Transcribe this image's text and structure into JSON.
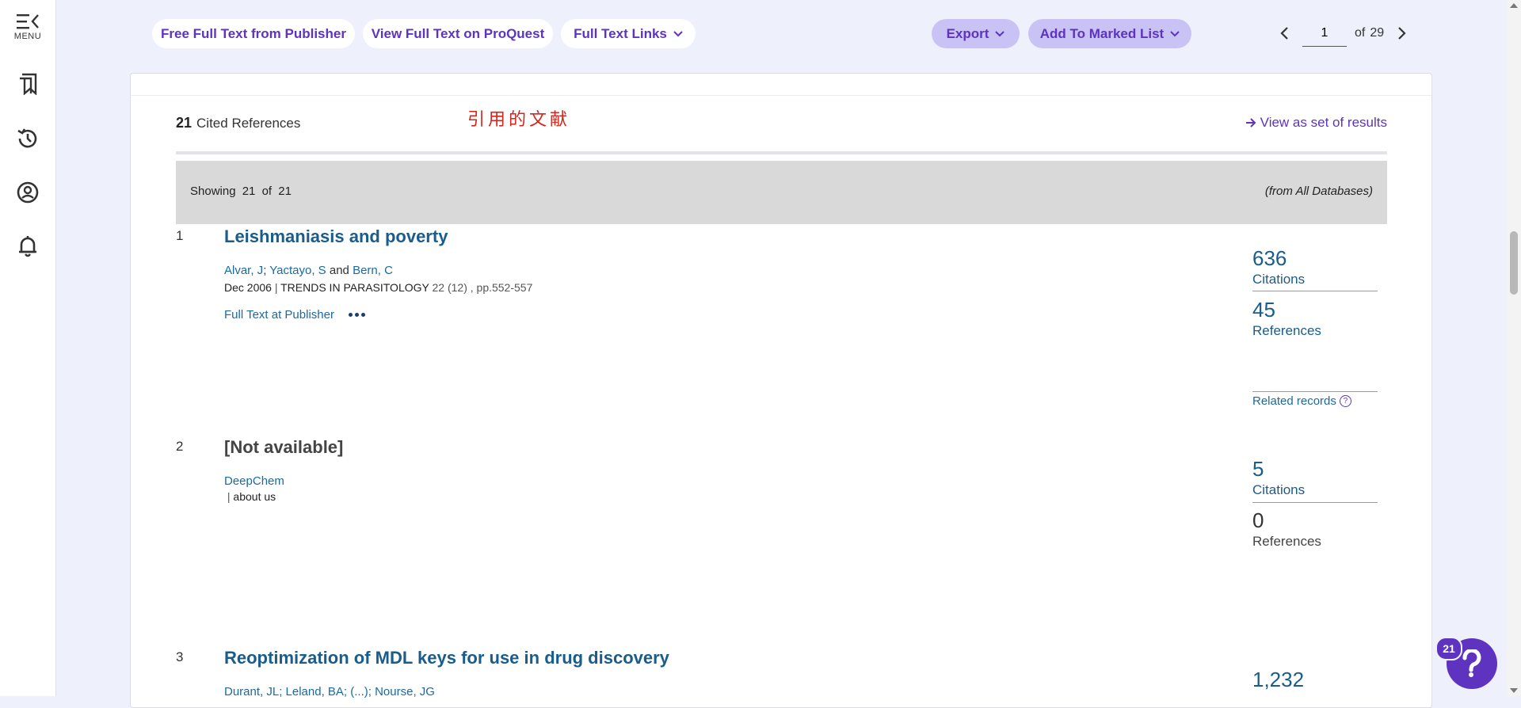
{
  "sidebar": {
    "menu_label": "MENU"
  },
  "toolbar": {
    "free_full_text": "Free Full Text from Publisher",
    "proquest": "View Full Text on ProQuest",
    "full_text_links": "Full Text Links",
    "export": "Export",
    "add_marked": "Add To Marked List",
    "page_current": "1",
    "page_of": "of",
    "page_total": "29"
  },
  "cited": {
    "count": "21",
    "label": "Cited References",
    "annotation": "引用的文献",
    "view_set": "View as set of results",
    "showing_word": "Showing",
    "showing_from": "21",
    "showing_of": "of",
    "showing_total": "21",
    "source": "(from All Databases)"
  },
  "records": [
    {
      "num": "1",
      "title": "Leishmaniasis and poverty",
      "author1": "Alvar, J",
      "sep1": ";",
      "author2": "Yactayo, S",
      "and": "and",
      "author3": "Bern, C",
      "date": "Dec 2006",
      "journal": "TRENDS IN PARASITOLOGY",
      "volume": "22 (12) , pp.552-557",
      "link": "Full Text at Publisher",
      "citations": "636",
      "citations_label": "Citations",
      "references": "45",
      "references_label": "References",
      "related": "Related records",
      "related_help": "?"
    },
    {
      "num": "2",
      "title": "[Not available]",
      "author1": "DeepChem",
      "meta": "about us",
      "citations": "5",
      "citations_label": "Citations",
      "references": "0",
      "references_label": "References"
    },
    {
      "num": "3",
      "title": "Reoptimization of MDL keys for use in drug discovery",
      "authors": "Durant, JL; Leland, BA; (...); Nourse, JG",
      "citations": "1,232"
    }
  ],
  "help": {
    "badge": "21"
  }
}
